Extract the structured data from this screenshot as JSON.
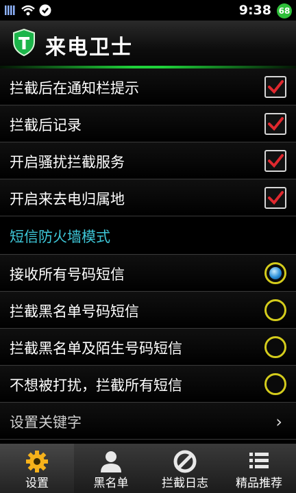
{
  "status_bar": {
    "time": "9:38",
    "battery": "68",
    "icons": [
      "signal-bars-icon",
      "wifi-icon",
      "shield-status-icon"
    ]
  },
  "header": {
    "title": "来电卫士",
    "logo_icon": "shield-t-icon"
  },
  "toggles": [
    {
      "label": "拦截后在通知栏提示",
      "checked": true
    },
    {
      "label": "拦截后记录",
      "checked": true
    },
    {
      "label": "开启骚扰拦截服务",
      "checked": true
    },
    {
      "label": "开启来去电归属地",
      "checked": true
    }
  ],
  "sms_section": {
    "title": "短信防火墙模式",
    "options": [
      {
        "label": "接收所有号码短信",
        "selected": true
      },
      {
        "label": "拦截黑名单号码短信",
        "selected": false
      },
      {
        "label": "拦截黑名单及陌生号码短信",
        "selected": false
      },
      {
        "label": "不想被打扰，拦截所有短信",
        "selected": false
      }
    ]
  },
  "keyword_row": {
    "label": "设置关键字"
  },
  "tabs": [
    {
      "label": "设置",
      "icon": "gear-icon",
      "active": true
    },
    {
      "label": "黑名单",
      "icon": "person-icon",
      "active": false
    },
    {
      "label": "拦截日志",
      "icon": "block-icon",
      "active": false
    },
    {
      "label": "精品推荐",
      "icon": "list-icon",
      "active": false
    }
  ],
  "colors": {
    "accent_green": "#1fd13a",
    "section_cyan": "#3ec7d8",
    "check_red": "#e0282e",
    "radio_yellow": "#d4cc1c"
  }
}
